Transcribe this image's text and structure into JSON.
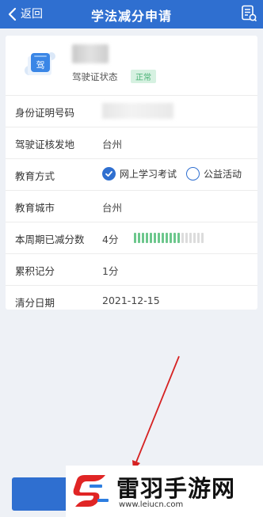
{
  "header": {
    "back_label": "返回",
    "title": "学法减分申请",
    "back_icon": "chevron-left-icon",
    "doc_icon": "document-list-icon"
  },
  "license": {
    "icon_char": "驾",
    "status_label": "驾驶证状态",
    "status_value": "正常"
  },
  "rows": {
    "id_number_label": "身份证明号码",
    "issue_place_label": "驾驶证核发地",
    "issue_place_value": "台州",
    "education_label": "教育方式",
    "education_options": [
      {
        "label": "网上学习考试",
        "selected": true
      },
      {
        "label": "公益活动",
        "selected": false
      }
    ],
    "education_city_label": "教育城市",
    "education_city_value": "台州",
    "period_reduced_label": "本周期已减分数",
    "period_reduced_value": "4分",
    "period_reduced_fraction": 0.67,
    "cumulative_label": "累积记分",
    "cumulative_value": "1分",
    "clear_date_label": "清分日期",
    "clear_date_value": "2021-12-15"
  },
  "colors": {
    "primary": "#2f6fd0",
    "progress_filled": "#6cc78c",
    "progress_empty": "#dcdcdc",
    "badge_bg": "#d6f1e1",
    "badge_text": "#47b073",
    "annotation": "#d62222"
  },
  "watermark": {
    "name": "雷羽手游网",
    "url": "www.leiucn.com"
  }
}
